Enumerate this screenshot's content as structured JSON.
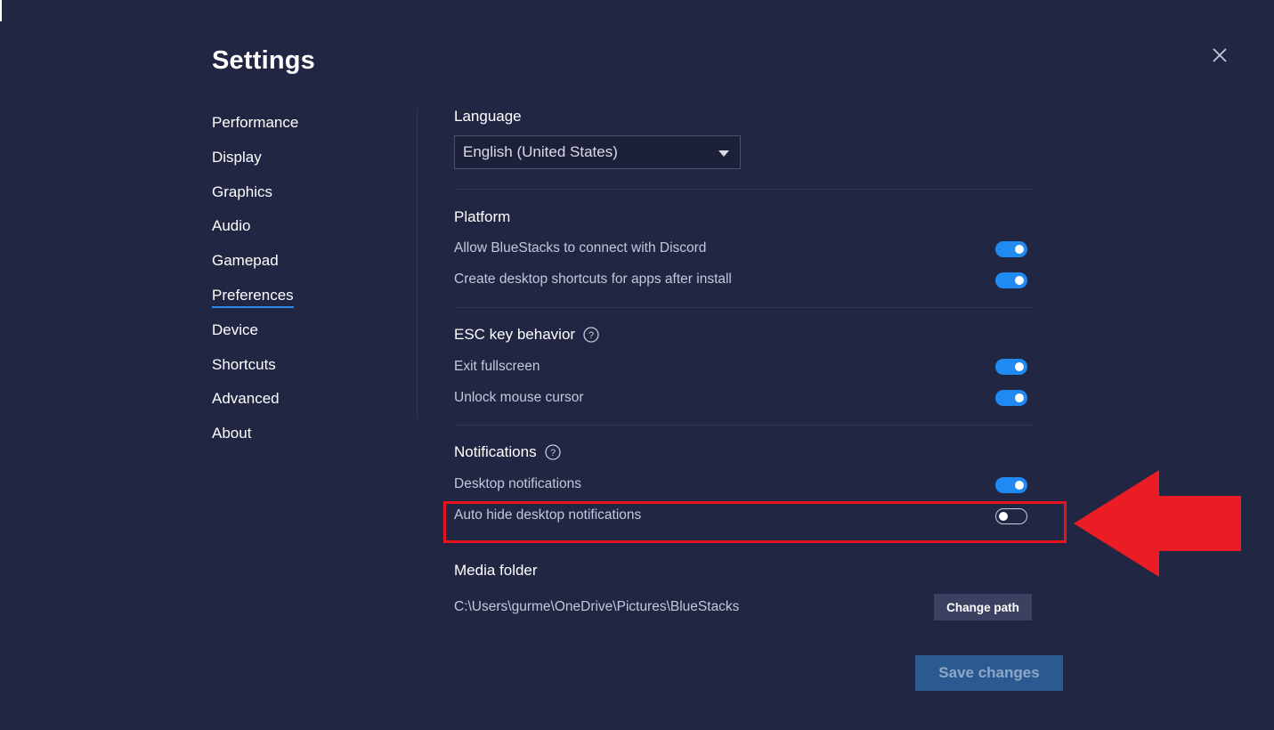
{
  "title": "Settings",
  "sidebar": {
    "items": [
      {
        "label": "Performance",
        "active": false
      },
      {
        "label": "Display",
        "active": false
      },
      {
        "label": "Graphics",
        "active": false
      },
      {
        "label": "Audio",
        "active": false
      },
      {
        "label": "Gamepad",
        "active": false
      },
      {
        "label": "Preferences",
        "active": true
      },
      {
        "label": "Device",
        "active": false
      },
      {
        "label": "Shortcuts",
        "active": false
      },
      {
        "label": "Advanced",
        "active": false
      },
      {
        "label": "About",
        "active": false
      }
    ]
  },
  "language": {
    "title": "Language",
    "selected": "English (United States)"
  },
  "platform": {
    "title": "Platform",
    "rows": [
      {
        "label": "Allow BlueStacks to connect with Discord",
        "enabled": true
      },
      {
        "label": "Create desktop shortcuts for apps after install",
        "enabled": true
      }
    ]
  },
  "esc": {
    "title": "ESC key behavior",
    "rows": [
      {
        "label": "Exit fullscreen",
        "enabled": true
      },
      {
        "label": "Unlock mouse cursor",
        "enabled": true
      }
    ]
  },
  "notifications": {
    "title": "Notifications",
    "rows": [
      {
        "label": "Desktop notifications",
        "enabled": true
      },
      {
        "label": "Auto hide desktop notifications",
        "enabled": false
      }
    ]
  },
  "media": {
    "title": "Media folder",
    "path": "C:\\Users\\gurme\\OneDrive\\Pictures\\BlueStacks",
    "change_label": "Change path"
  },
  "save_label": "Save changes",
  "colors": {
    "background": "#212643",
    "accent": "#1f8bf2",
    "annotation": "#e5131d"
  },
  "icons": {
    "close": "close-icon",
    "help": "help-icon",
    "dropdown": "chevron-down-icon",
    "annotation_arrow": "arrow-left-icon"
  }
}
